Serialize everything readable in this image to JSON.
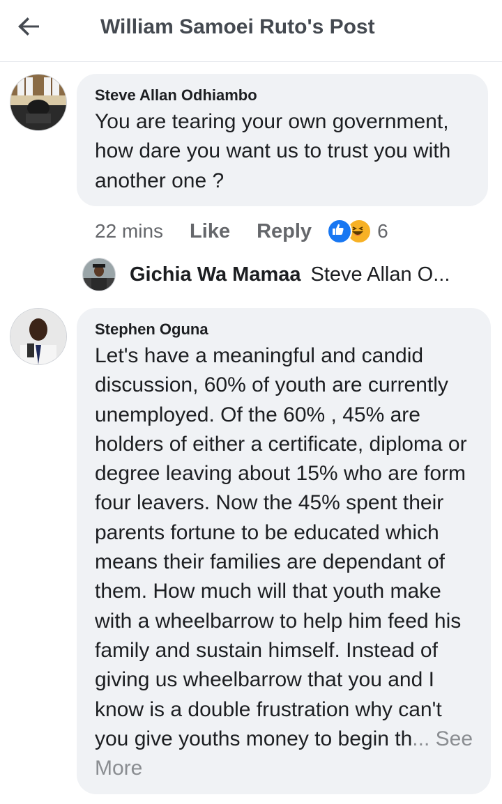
{
  "header": {
    "title": "William Samoei Ruto's Post",
    "back_icon": "arrow-left-icon"
  },
  "comments": [
    {
      "author": "Steve Allan Odhiambo",
      "text": "You are tearing your own government, how dare you want us to trust you with another one ?",
      "time": "22 mins",
      "like_label": "Like",
      "reply_label": "Reply",
      "reactions": [
        "like-icon",
        "haha-icon"
      ],
      "reaction_count": "6",
      "reply_preview": {
        "author": "Gichia Wa Mamaa",
        "text": "Steve Allan O..."
      }
    },
    {
      "author": "Stephen Oguna",
      "text": "Let's have a meaningful and candid discussion, 60% of youth are currently unemployed. Of the 60% , 45% are holders of either a certificate, diploma or degree leaving about 15% who  are form four leavers. Now the 45% spent their parents fortune to be educated which means their families are dependant of them. How much will that youth make with a wheelbarrow to help him feed his family and sustain himself. Instead of giving us wheelbarrow that you and I know is a double frustration  why can't you give youths money to begin th",
      "ellipsis": "...",
      "see_more": " See More"
    }
  ],
  "colors": {
    "bubble": "#f0f2f5",
    "secondary_text": "#65676b",
    "like_blue": "#1877f2",
    "haha_yellow": "#f7b125"
  }
}
